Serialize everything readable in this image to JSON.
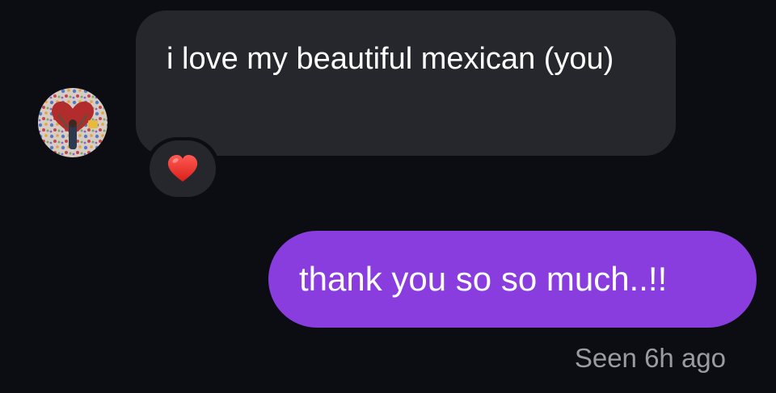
{
  "thread": {
    "incoming_message": {
      "text": "i love my beautiful mexican (you)",
      "reaction": "❤️",
      "avatar_icon": "profile-photo"
    },
    "outgoing_message": {
      "text": "thank you so so much..!!"
    },
    "status": "Seen 6h ago"
  },
  "colors": {
    "background": "#0c0d12",
    "incoming_bubble": "#25272c",
    "outgoing_bubble": "#8a3ddf",
    "status_text": "#9a9ba3"
  }
}
